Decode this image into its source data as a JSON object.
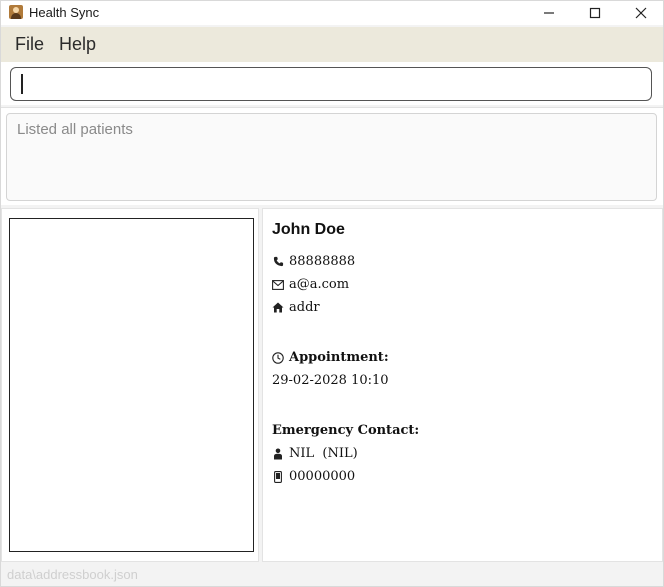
{
  "window": {
    "title": "Health Sync"
  },
  "menu": {
    "file": "File",
    "help": "Help"
  },
  "command": {
    "value": ""
  },
  "result": {
    "message": "Listed all patients"
  },
  "patient": {
    "name": "John Doe",
    "phone": "88888888",
    "email": "a@a.com",
    "address": "addr",
    "appointment_label": "Appointment:",
    "appointment_value": "29-02-2028 10:10",
    "emergency_label": "Emergency Contact:",
    "emergency_name": "NIL  (NIL)",
    "emergency_phone": "00000000"
  },
  "footer": {
    "path": "data\\addressbook.json"
  },
  "icons": {
    "phone": "phone-icon",
    "email": "envelope-icon",
    "address": "home-icon",
    "appointment": "clock-icon",
    "emergency_name": "person-icon",
    "emergency_phone": "mobile-icon"
  }
}
